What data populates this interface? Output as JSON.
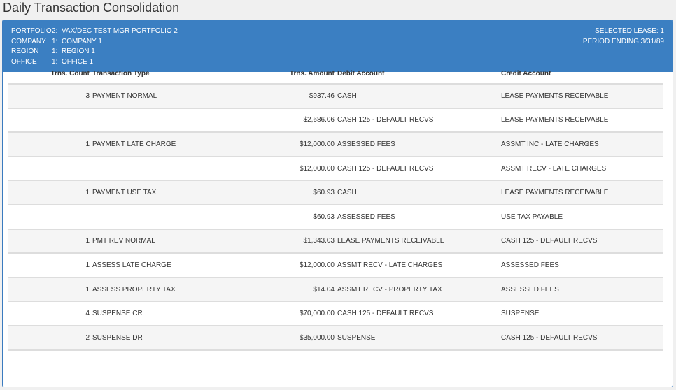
{
  "page": {
    "title": "Daily Transaction Consolidation"
  },
  "header": {
    "rows": [
      {
        "label": "PORTFOLIO",
        "code": "2:",
        "value": "VAX/DEC TEST MGR PORTFOLIO 2"
      },
      {
        "label": "COMPANY",
        "code": "1:",
        "value": "COMPANY 1"
      },
      {
        "label": "REGION",
        "code": "1:",
        "value": "REGION 1"
      },
      {
        "label": "OFFICE",
        "code": "1:",
        "value": "OFFICE 1"
      }
    ],
    "selected_lease": "SELECTED LEASE: 1",
    "period_ending": "PERIOD ENDING 3/31/89"
  },
  "table": {
    "columns": {
      "count": "Trns. Count",
      "type": "Transaction Type",
      "amount": "Trns. Amount",
      "debit": "Debit Account",
      "credit": "Credit Account"
    },
    "rows": [
      {
        "count": "3",
        "type": "PAYMENT NORMAL",
        "amount": "$937.46",
        "debit": "CASH",
        "credit": "LEASE PAYMENTS RECEIVABLE"
      },
      {
        "count": "",
        "type": "",
        "amount": "$2,686.06",
        "debit": "CASH 125 - DEFAULT RECVS",
        "credit": "LEASE PAYMENTS RECEIVABLE"
      },
      {
        "count": "1",
        "type": "PAYMENT LATE CHARGE",
        "amount": "$12,000.00",
        "debit": "ASSESSED FEES",
        "credit": "ASSMT INC - LATE CHARGES"
      },
      {
        "count": "",
        "type": "",
        "amount": "$12,000.00",
        "debit": "CASH 125 - DEFAULT RECVS",
        "credit": "ASSMT RECV - LATE CHARGES"
      },
      {
        "count": "1",
        "type": "PAYMENT USE TAX",
        "amount": "$60.93",
        "debit": "CASH",
        "credit": "LEASE PAYMENTS RECEIVABLE"
      },
      {
        "count": "",
        "type": "",
        "amount": "$60.93",
        "debit": "ASSESSED FEES",
        "credit": "USE TAX PAYABLE"
      },
      {
        "count": "1",
        "type": "PMT REV NORMAL",
        "amount": "$1,343.03",
        "debit": "LEASE PAYMENTS RECEIVABLE",
        "credit": "CASH 125 - DEFAULT RECVS"
      },
      {
        "count": "1",
        "type": "ASSESS LATE CHARGE",
        "amount": "$12,000.00",
        "debit": "ASSMT RECV - LATE CHARGES",
        "credit": "ASSESSED FEES"
      },
      {
        "count": "1",
        "type": "ASSESS PROPERTY TAX",
        "amount": "$14.04",
        "debit": "ASSMT RECV - PROPERTY TAX",
        "credit": "ASSESSED FEES"
      },
      {
        "count": "4",
        "type": "SUSPENSE CR",
        "amount": "$70,000.00",
        "debit": "CASH 125 - DEFAULT RECVS",
        "credit": "SUSPENSE"
      },
      {
        "count": "2",
        "type": "SUSPENSE DR",
        "amount": "$35,000.00",
        "debit": "SUSPENSE",
        "credit": "CASH 125 - DEFAULT RECVS"
      }
    ]
  }
}
